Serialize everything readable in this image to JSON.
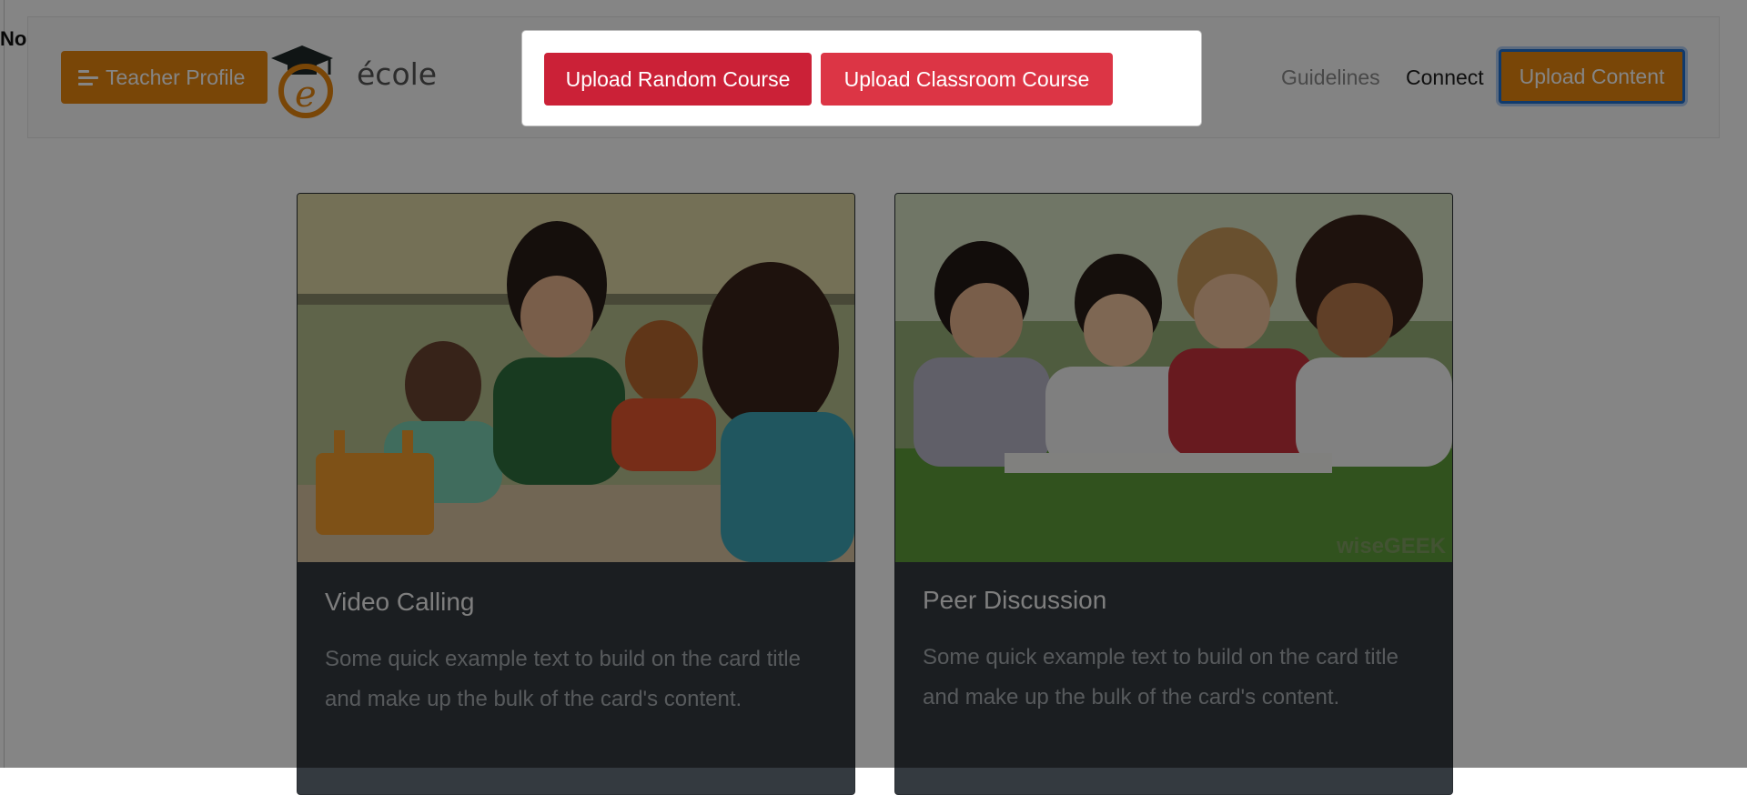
{
  "stray_text": "No",
  "navbar": {
    "profile_button": "Teacher Profile",
    "logo_text": "école",
    "links": {
      "guidelines": "Guidelines",
      "connect": "Connect"
    },
    "upload_button": "Upload Content"
  },
  "popover": {
    "upload_random": "Upload Random Course",
    "upload_classroom": "Upload Classroom Course"
  },
  "cards": [
    {
      "title": "Video Calling",
      "text": "Some quick example text to build on the card title and make up the bulk of the card's content."
    },
    {
      "title": "Peer Discussion",
      "text": "Some quick example text to build on the card title and make up the bulk of the card's content.",
      "image_watermark": "wiseGEEK"
    }
  ],
  "colors": {
    "orange": "#e8870f",
    "red_primary": "#cb2137",
    "red_secondary": "#dc3545",
    "card_dark": "#343a40",
    "focus_ring": "#1f6fd0"
  },
  "icons": [
    "menu-lines-icon",
    "graduation-cap-icon"
  ]
}
